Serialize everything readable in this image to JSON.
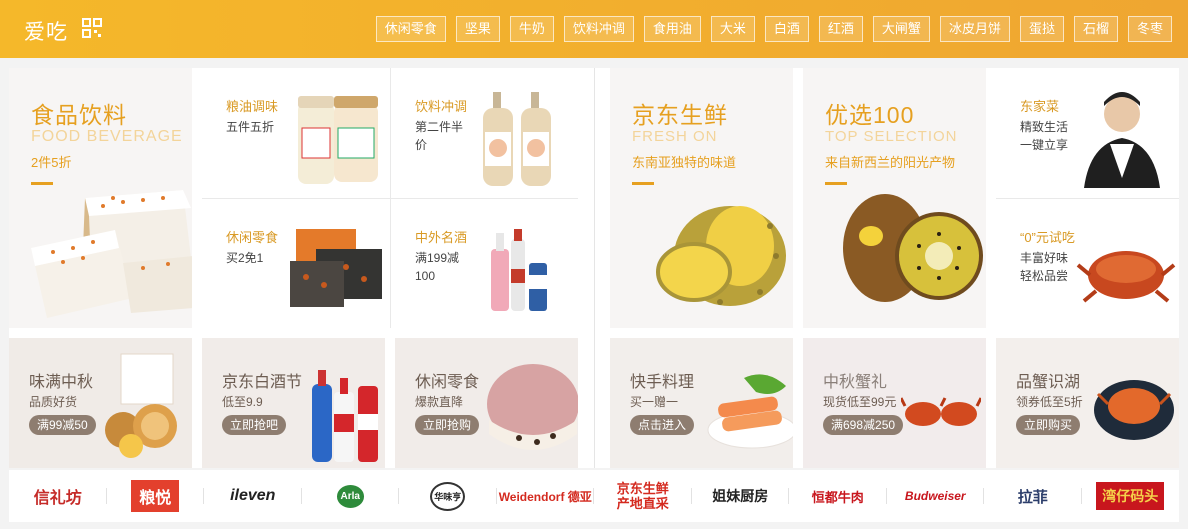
{
  "header": {
    "logo": "爱吃",
    "qr_icon": "qr-code-icon",
    "tags": [
      "休闲零食",
      "坚果",
      "牛奶",
      "饮料冲调",
      "食用油",
      "大米",
      "白酒",
      "红酒",
      "大闸蟹",
      "冰皮月饼",
      "蛋挞",
      "石榴",
      "冬枣"
    ]
  },
  "left_big": {
    "title": "食品饮料",
    "subtitle": "FOOD BEVERAGE",
    "desc": "2件5折"
  },
  "left_items": [
    {
      "title": "粮油调味",
      "desc": "五件五折"
    },
    {
      "title": "饮料冲调",
      "desc": "第二件半价"
    },
    {
      "title": "休闲零食",
      "desc": "买2免1"
    },
    {
      "title": "中外名酒",
      "desc": "满199减100"
    }
  ],
  "right_big1": {
    "title": "京东生鲜",
    "subtitle": "FRESH ON",
    "desc": "东南亚独特的味道"
  },
  "right_big2": {
    "title": "优选100",
    "subtitle": "TOP SELECTION",
    "desc": "来自新西兰的阳光产物"
  },
  "right_items": [
    {
      "title": "东家菜",
      "desc": "精致生活 一键立享"
    },
    {
      "title": "“0”元试吃",
      "desc": "丰富好味 轻松品尝"
    }
  ],
  "strips": [
    {
      "title": "味满中秋",
      "sub": "品质好货",
      "pill": "满99减50"
    },
    {
      "title": "京东白酒节",
      "sub": "低至9.9",
      "pill": "立即抢吧"
    },
    {
      "title": "休闲零食",
      "sub": "爆款直降",
      "pill": "立即抢购"
    },
    {
      "title": "快手料理",
      "sub": "买一赠一",
      "pill": "点击进入"
    },
    {
      "title": "中秋蟹礼",
      "sub": "现货低至99元",
      "pill": "满698减250"
    },
    {
      "title": "品蟹识湖",
      "sub": "领券低至5折",
      "pill": "立即购买"
    }
  ],
  "brands": [
    "信礼坊",
    "粮悦",
    "ileven",
    "Arla",
    "华味亨",
    "Weidendorf 德亚",
    "京东生鲜 产地直采",
    "姐妹厨房",
    "恒都牛肉",
    "Budweiser",
    "拉菲",
    "湾仔码头"
  ]
}
